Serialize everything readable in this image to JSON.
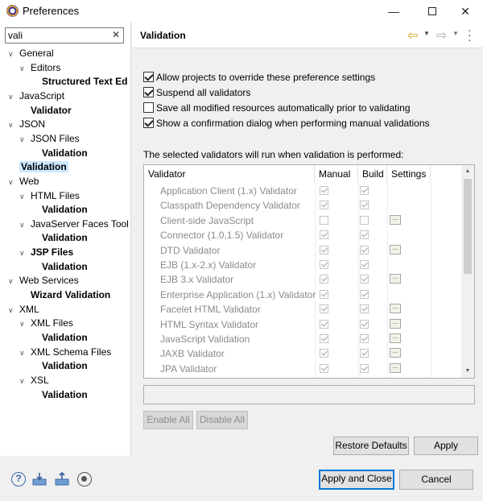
{
  "window": {
    "title": "Preferences",
    "minimize": "—",
    "close": "✕"
  },
  "filter": {
    "value": "vali",
    "clear": "✕"
  },
  "tree": [
    {
      "label": "General",
      "expanded": true,
      "bold": false,
      "selected": false
    },
    {
      "label": "Editors",
      "expanded": true,
      "bold": false,
      "selected": false
    },
    {
      "label": "Structured Text Ed",
      "bold": true,
      "selected": false
    },
    {
      "label": "JavaScript",
      "expanded": true,
      "bold": false,
      "selected": false
    },
    {
      "label": "Validator",
      "bold": true,
      "selected": false
    },
    {
      "label": "JSON",
      "expanded": true,
      "bold": false,
      "selected": false
    },
    {
      "label": "JSON Files",
      "expanded": true,
      "bold": false,
      "selected": false
    },
    {
      "label": "Validation",
      "bold": true,
      "selected": false
    },
    {
      "label": "Validation",
      "bold": true,
      "selected": true
    },
    {
      "label": "Web",
      "expanded": true,
      "bold": false,
      "selected": false
    },
    {
      "label": "HTML Files",
      "expanded": true,
      "bold": false,
      "selected": false
    },
    {
      "label": "Validation",
      "bold": true,
      "selected": false
    },
    {
      "label": "JavaServer Faces Tool",
      "expanded": true,
      "bold": false,
      "selected": false
    },
    {
      "label": "Validation",
      "bold": true,
      "selected": false
    },
    {
      "label": "JSP Files",
      "expanded": true,
      "bold": true,
      "selected": false
    },
    {
      "label": "Validation",
      "bold": true,
      "selected": false
    },
    {
      "label": "Web Services",
      "expanded": true,
      "bold": false,
      "selected": false
    },
    {
      "label": "Wizard Validation",
      "bold": true,
      "selected": false
    },
    {
      "label": "XML",
      "expanded": true,
      "bold": false,
      "selected": false
    },
    {
      "label": "XML Files",
      "expanded": true,
      "bold": false,
      "selected": false
    },
    {
      "label": "Validation",
      "bold": true,
      "selected": false
    },
    {
      "label": "XML Schema Files",
      "expanded": true,
      "bold": false,
      "selected": false
    },
    {
      "label": "Validation",
      "bold": true,
      "selected": false
    },
    {
      "label": "XSL",
      "expanded": true,
      "bold": false,
      "selected": false
    },
    {
      "label": "Validation",
      "bold": true,
      "selected": false
    }
  ],
  "page": {
    "title": "Validation",
    "options": [
      {
        "label": "Allow projects to override these preference settings",
        "checked": true
      },
      {
        "label": "Suspend all validators",
        "checked": true
      },
      {
        "label": "Save all modified resources automatically prior to validating",
        "checked": false
      },
      {
        "label": "Show a confirmation dialog when performing manual validations",
        "checked": true
      }
    ],
    "description": "The selected validators will run when validation is performed:",
    "table": {
      "columns": [
        "Validator",
        "Manual",
        "Build",
        "Settings"
      ],
      "rows": [
        {
          "name": "Application Client (1.x) Validator",
          "manual": true,
          "build": true,
          "settings": false
        },
        {
          "name": "Classpath Dependency Validator",
          "manual": true,
          "build": true,
          "settings": false
        },
        {
          "name": "Client-side JavaScript",
          "manual": false,
          "build": false,
          "settings": true
        },
        {
          "name": "Connector (1.0,1.5) Validator",
          "manual": true,
          "build": true,
          "settings": false
        },
        {
          "name": "DTD Validator",
          "manual": true,
          "build": true,
          "settings": true
        },
        {
          "name": "EJB (1.x-2.x) Validator",
          "manual": true,
          "build": true,
          "settings": false
        },
        {
          "name": "EJB 3.x Validator",
          "manual": true,
          "build": true,
          "settings": true
        },
        {
          "name": "Enterprise Application (1.x) Validator",
          "manual": true,
          "build": true,
          "settings": false
        },
        {
          "name": "Facelet HTML Validator",
          "manual": true,
          "build": true,
          "settings": true
        },
        {
          "name": "HTML Syntax Validator",
          "manual": true,
          "build": true,
          "settings": true
        },
        {
          "name": "JavaScript Validation",
          "manual": true,
          "build": true,
          "settings": true
        },
        {
          "name": "JAXB Validator",
          "manual": true,
          "build": true,
          "settings": true
        },
        {
          "name": "JPA Validator",
          "manual": true,
          "build": true,
          "settings": true
        },
        {
          "name": "",
          "manual": true,
          "build": true,
          "settings": true
        }
      ]
    },
    "buttons": {
      "enable_all": "Enable All",
      "disable_all": "Disable All",
      "restore_defaults": "Restore Defaults",
      "apply": "Apply"
    }
  },
  "footer": {
    "help_icon": "?",
    "apply_and_close": "Apply and Close",
    "cancel": "Cancel"
  }
}
